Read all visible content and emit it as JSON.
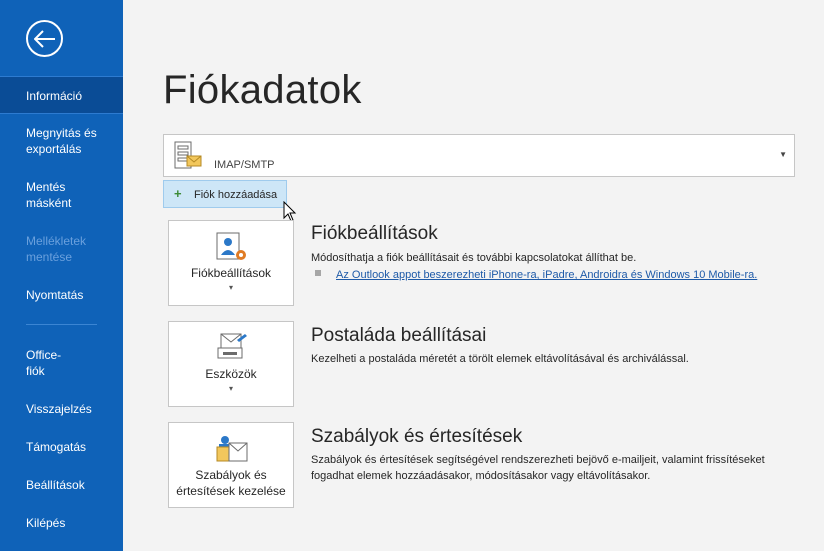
{
  "sidebar": {
    "items": [
      {
        "label": "Információ"
      },
      {
        "label": "Megnyitás és exportálás"
      },
      {
        "label": "Mentés másként"
      },
      {
        "label": "Mellékletek mentése"
      },
      {
        "label": "Nyomtatás"
      },
      {
        "label": "Office-fiók"
      },
      {
        "label": "Visszajelzés"
      },
      {
        "label": "Támogatás"
      },
      {
        "label": "Beállítások"
      },
      {
        "label": "Kilépés"
      }
    ]
  },
  "main": {
    "title": "Fiókadatok",
    "account": {
      "label": "IMAP/SMTP"
    },
    "add_account_label": "Fiók hozzáadása",
    "sections": [
      {
        "tile_label": "Fiókbeállítások",
        "title": "Fiókbeállítások",
        "description": "Módosíthatja a fiók beállításait és további kapcsolatokat állíthat be.",
        "link": "Az Outlook appot beszerezheti iPhone-ra, iPadre, Androidra és Windows 10 Mobile-ra."
      },
      {
        "tile_label": "Eszközök",
        "title": "Postaláda beállításai",
        "description": "Kezelheti a postaláda méretét a törölt elemek eltávolításával és archiválással."
      },
      {
        "tile_label": "Szabályok és értesítések kezelése",
        "title": "Szabályok és értesítések",
        "description": "Szabályok és értesítések segítségével rendszerezheti bejövő e-mailjeit, valamint frissítéseket fogadhat elemek hozzáadásakor, módosításakor vagy eltávolításakor."
      }
    ]
  },
  "colors": {
    "sidebar": "#0f62b8",
    "sidebar_active": "#0a4c96",
    "link": "#1e5aa8",
    "add_button_bg": "#cde6f7"
  }
}
